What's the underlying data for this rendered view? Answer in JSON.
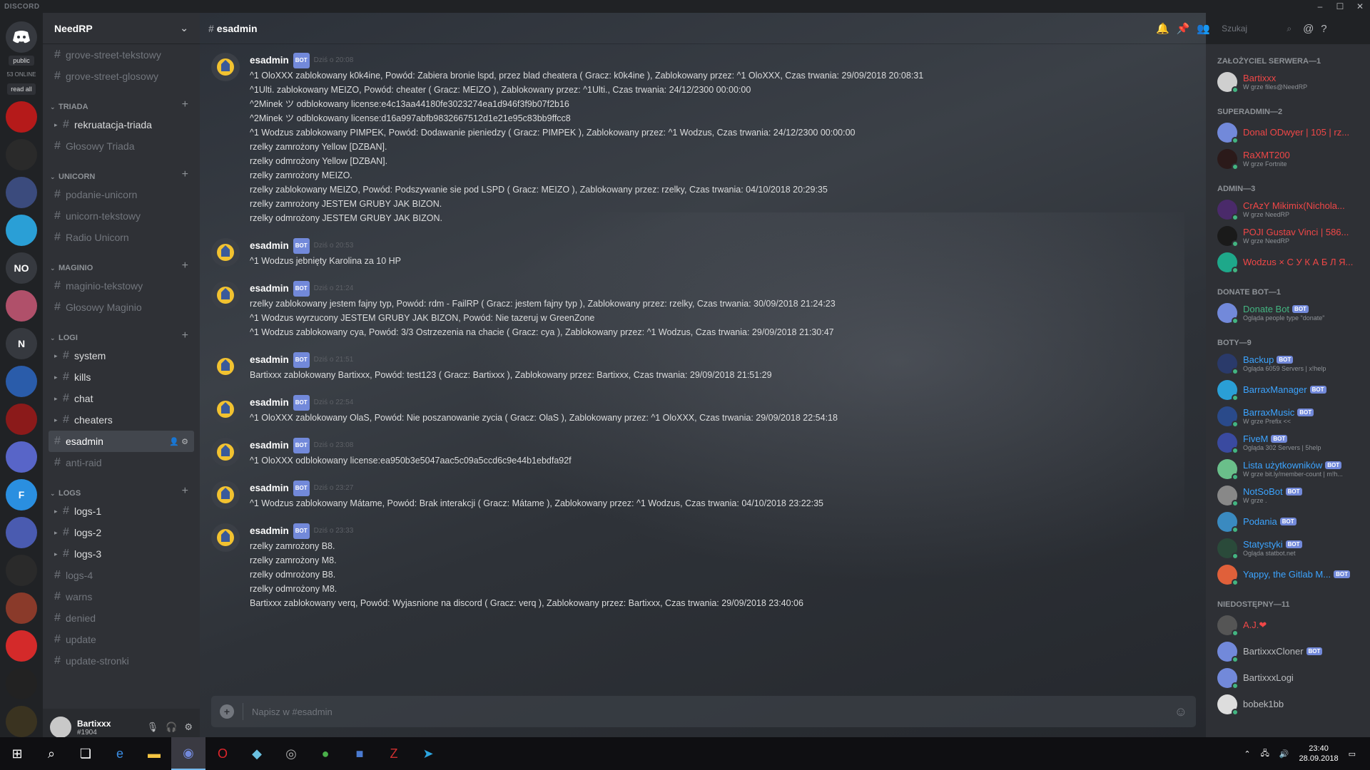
{
  "app": {
    "brand": "DISCORD"
  },
  "guilds": {
    "public_label": "public",
    "online_label": "53 ONLINE",
    "read_all": "read all",
    "items": [
      {
        "label": "",
        "color": "#b51a1a"
      },
      {
        "label": "",
        "color": "#2a2a2a"
      },
      {
        "label": "",
        "color": "#3b4b7d"
      },
      {
        "label": "",
        "color": "#2a9fd6"
      },
      {
        "label": "NO",
        "color": "#36393f"
      },
      {
        "label": "",
        "color": "#b0506a"
      },
      {
        "label": "N",
        "color": "#36393f"
      },
      {
        "label": "",
        "color": "#2a5caa"
      },
      {
        "label": "",
        "color": "#8b1a1a"
      },
      {
        "label": "",
        "color": "#5865c8"
      },
      {
        "label": "F",
        "color": "#2a8fe0"
      },
      {
        "label": "",
        "color": "#4a5bb0"
      },
      {
        "label": "",
        "color": "#2a2a2a"
      },
      {
        "label": "",
        "color": "#8a3a2a"
      },
      {
        "label": "",
        "color": "#d42a2a"
      },
      {
        "label": "",
        "color": "#222222"
      },
      {
        "label": "",
        "color": "#3a3320"
      }
    ]
  },
  "server": {
    "name": "NeedRP"
  },
  "channels": {
    "top": [
      "grove-street-tekstowy",
      "grove-street-glosowy"
    ],
    "triada": {
      "title": "TRIADA",
      "items": [
        "rekruatacja-triada",
        "Głosowy Triada"
      ]
    },
    "unicorn": {
      "title": "UNICORN",
      "items": [
        "podanie-unicorn",
        "unicorn-tekstowy",
        "Radio Unicorn"
      ]
    },
    "maginio": {
      "title": "MAGINIO",
      "items": [
        "maginio-tekstowy",
        "Głosowy Maginio"
      ]
    },
    "logi": {
      "title": "LOGI",
      "items": [
        "system",
        "kills",
        "chat",
        "cheaters",
        "esadmin",
        "anti-raid"
      ]
    },
    "logs": {
      "title": "LOGS",
      "items": [
        "logs-1",
        "logs-2",
        "logs-3",
        "logs-4",
        "warns",
        "denied",
        "update",
        "update-stronki"
      ]
    }
  },
  "user": {
    "name": "Bartixxx",
    "tag": "#1904"
  },
  "header": {
    "channel": "esadmin",
    "search_placeholder": "Szukaj"
  },
  "messages": [
    {
      "author": "esadmin",
      "bot": "BOT",
      "time": "Dziś o 20:08",
      "lines": [
        "^1 OloXXX zablokowany k0k4ine, Powód: Zabiera bronie lspd, przez blad cheatera ( Gracz: k0k4ine ), Zablokowany przez: ^1 OloXXX, Czas trwania: 29/09/2018    20:08:31",
        "^1Ulti. zablokowany MEIZO, Powód: cheater ( Gracz: MEIZO ), Zablokowany przez: ^1Ulti., Czas trwania: 24/12/2300    00:00:00",
        "^2Minek ツ odblokowany license:e4c13aa44180fe3023274ea1d946f3f9b07f2b16",
        "^2Minek ツ odblokowany license:d16a997abfb9832667512d1e21e95c83bb9ffcc8",
        "^1 Wodzus zablokowany PIMPEK, Powód: Dodawanie pieniedzy ( Gracz: PIMPEK ), Zablokowany przez: ^1 Wodzus, Czas trwania: 24/12/2300    00:00:00",
        "rzelky zamrożony Yellow [DZBAN].",
        "rzelky odmrożony Yellow [DZBAN].",
        "rzelky zamrożony MEIZO.",
        "rzelky zablokowany MEIZO, Powód: Podszywanie sie pod LSPD ( Gracz: MEIZO ), Zablokowany przez: rzelky, Czas trwania: 04/10/2018    20:29:35",
        "rzelky zamrożony JESTEM GRUBY JAK BIZON.",
        "rzelky odmrożony JESTEM GRUBY JAK BIZON."
      ]
    },
    {
      "author": "esadmin",
      "bot": "BOT",
      "time": "Dziś o 20:53",
      "lines": [
        "^1 Wodzus jebnięty Karolina za 10 HP"
      ]
    },
    {
      "author": "esadmin",
      "bot": "BOT",
      "time": "Dziś o 21:24",
      "lines": [
        "rzelky zablokowany jestem fajny typ, Powód: rdm - FailRP ( Gracz: jestem fajny typ ), Zablokowany przez: rzelky, Czas trwania: 30/09/2018    21:24:23",
        "^1 Wodzus wyrzucony JESTEM GRUBY JAK BIZON, Powód: Nie tazeruj w GreenZone",
        "^1 Wodzus zablokowany cya, Powód: 3/3 Ostrzezenia na chacie ( Gracz: cya ), Zablokowany przez: ^1 Wodzus, Czas trwania: 29/09/2018    21:30:47"
      ]
    },
    {
      "author": "esadmin",
      "bot": "BOT",
      "time": "Dziś o 21:51",
      "lines": [
        "Bartixxx zablokowany Bartixxx, Powód: test123 ( Gracz: Bartixxx ), Zablokowany przez: Bartixxx, Czas trwania: 29/09/2018    21:51:29"
      ]
    },
    {
      "author": "esadmin",
      "bot": "BOT",
      "time": "Dziś o 22:54",
      "lines": [
        "^1 OloXXX zablokowany OlaS, Powód: Nie poszanowanie zycia ( Gracz: OlaS ), Zablokowany przez: ^1 OloXXX, Czas trwania: 29/09/2018    22:54:18"
      ]
    },
    {
      "author": "esadmin",
      "bot": "BOT",
      "time": "Dziś o 23:08",
      "lines": [
        "^1 OloXXX odblokowany license:ea950b3e5047aac5c09a5ccd6c9e44b1ebdfa92f"
      ]
    },
    {
      "author": "esadmin",
      "bot": "BOT",
      "time": "Dziś o 23:27",
      "lines": [
        "^1 Wodzus zablokowany Mátame, Powód: Brak interakcji ( Gracz: Mátame ), Zablokowany przez: ^1 Wodzus, Czas trwania: 04/10/2018    23:22:35"
      ]
    },
    {
      "author": "esadmin",
      "bot": "BOT",
      "time": "Dziś o 23:33",
      "lines": [
        "rzelky zamrożony B8.",
        "rzelky zamrożony M8.",
        "rzelky odmrożony B8.",
        "rzelky odmrożony M8.",
        "Bartixxx zablokowany verq, Powód: Wyjasnione na discord ( Gracz: verq ), Zablokowany przez: Bartixxx, Czas trwania: 29/09/2018    23:40:06"
      ]
    }
  ],
  "composer": {
    "placeholder": "Napisz w #esadmin"
  },
  "members": {
    "groups": [
      {
        "title": "ZAŁOŻYCIEL SERWERA",
        "count": "—1",
        "members": [
          {
            "name": "Bartixxx",
            "status": "W grze files@NeedRP",
            "color": "#f04747",
            "avatar": "#cfcfcf"
          }
        ]
      },
      {
        "title": "SUPERADMIN",
        "count": "—2",
        "members": [
          {
            "name": "Donal ODwyer | 105 | rz...",
            "status": "",
            "color": "#f04747",
            "avatar": "#7289da"
          },
          {
            "name": "RaXMT200",
            "status": "W grze Fortnite",
            "color": "#f04747",
            "avatar": "#2b1a1a"
          }
        ]
      },
      {
        "title": "ADMIN",
        "count": "—3",
        "members": [
          {
            "name": "CrAzY Mikimix(Nichola...",
            "status": "W grze NeedRP",
            "color": "#f04747",
            "avatar": "#4a2a6a"
          },
          {
            "name": "POJI Gustav Vinci | 586...",
            "status": "W grze NeedRP",
            "color": "#f04747",
            "avatar": "#1a1a1a"
          },
          {
            "name": "Wodzus × С У К А Б Л Я...",
            "status": "",
            "color": "#f04747",
            "avatar": "#1ea88a"
          }
        ]
      },
      {
        "title": "DONATE BOT",
        "count": "—1",
        "members": [
          {
            "name": "Donate Bot",
            "bot": "BOT",
            "status": "Ogląda people type \"donate\"",
            "color": "#43b581",
            "avatar": "#7289da"
          }
        ]
      },
      {
        "title": "BOTY",
        "count": "—9",
        "members": [
          {
            "name": "Backup",
            "bot": "BOT",
            "status": "Ogląda 6059 Servers | x!help",
            "color": "#3ca4ff",
            "avatar": "#2a3a6a"
          },
          {
            "name": "BarraxManager",
            "bot": "BOT",
            "status": "",
            "color": "#3ca4ff",
            "avatar": "#2a9fd6"
          },
          {
            "name": "BarraxMusic",
            "bot": "BOT",
            "status": "W grze Prefix <<",
            "color": "#3ca4ff",
            "avatar": "#2a4a8a"
          },
          {
            "name": "FiveM",
            "bot": "BOT",
            "status": "Ogląda 302 Servers | 5help",
            "color": "#3ca4ff",
            "avatar": "#3a4aa0"
          },
          {
            "name": "Lista użytkowników",
            "bot": "BOT",
            "status": "W grze bit.ly/member-count | m!h...",
            "color": "#3ca4ff",
            "avatar": "#6abf8a"
          },
          {
            "name": "NotSoBot",
            "bot": "BOT",
            "status": "W grze .",
            "color": "#3ca4ff",
            "avatar": "#888888"
          },
          {
            "name": "Podania",
            "bot": "BOT",
            "status": "",
            "color": "#3ca4ff",
            "avatar": "#3a8ac0"
          },
          {
            "name": "Statystyki",
            "bot": "BOT",
            "status": "Ogląda statbot.net",
            "color": "#3ca4ff",
            "avatar": "#2a4a3a"
          },
          {
            "name": "Yappy, the Gitlab M...",
            "bot": "BOT",
            "status": "",
            "color": "#3ca4ff",
            "avatar": "#e0603a"
          }
        ]
      },
      {
        "title": "NIEDOSTĘPNY",
        "count": "—11",
        "members": [
          {
            "name": "A.J.❤",
            "status": "",
            "color": "#f04747",
            "avatar": "#555555"
          },
          {
            "name": "BartixxxCloner",
            "bot": "BOT",
            "status": "",
            "color": "#b9bbbe",
            "avatar": "#7289da"
          },
          {
            "name": "BartixxxLogi",
            "status": "",
            "color": "#b9bbbe",
            "avatar": "#7289da"
          },
          {
            "name": "bobek1bb",
            "status": "",
            "color": "#b9bbbe",
            "avatar": "#dddddd"
          }
        ]
      }
    ]
  },
  "taskbar": {
    "time": "23:40",
    "date": "28.09.2018"
  }
}
